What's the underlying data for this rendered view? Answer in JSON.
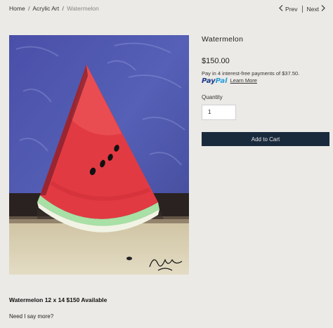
{
  "breadcrumb": {
    "home": "Home",
    "category": "Acrylic Art",
    "current": "Watermelon",
    "separator": "/"
  },
  "pager": {
    "prev": "Prev",
    "next": "Next",
    "prev_icon": "chevron-left-icon",
    "next_icon": "chevron-right-icon"
  },
  "product": {
    "title": "Watermelon",
    "price": "$150.00",
    "paypal_text": "Pay in 4 interest-free payments of $37.50.",
    "paypal_logo": "PayPal",
    "learn_more": "Learn More",
    "quantity_label": "Quantity",
    "quantity_value": "1",
    "add_to_cart": "Add to Cart"
  },
  "description": {
    "headline": "Watermelon 12 x 14 $150 Available",
    "body": "Need I say more?"
  },
  "colors": {
    "background": "#eceae6",
    "button": "#1a2a3d",
    "paypal_dark": "#1b3a8a",
    "paypal_light": "#2a9fd9"
  }
}
